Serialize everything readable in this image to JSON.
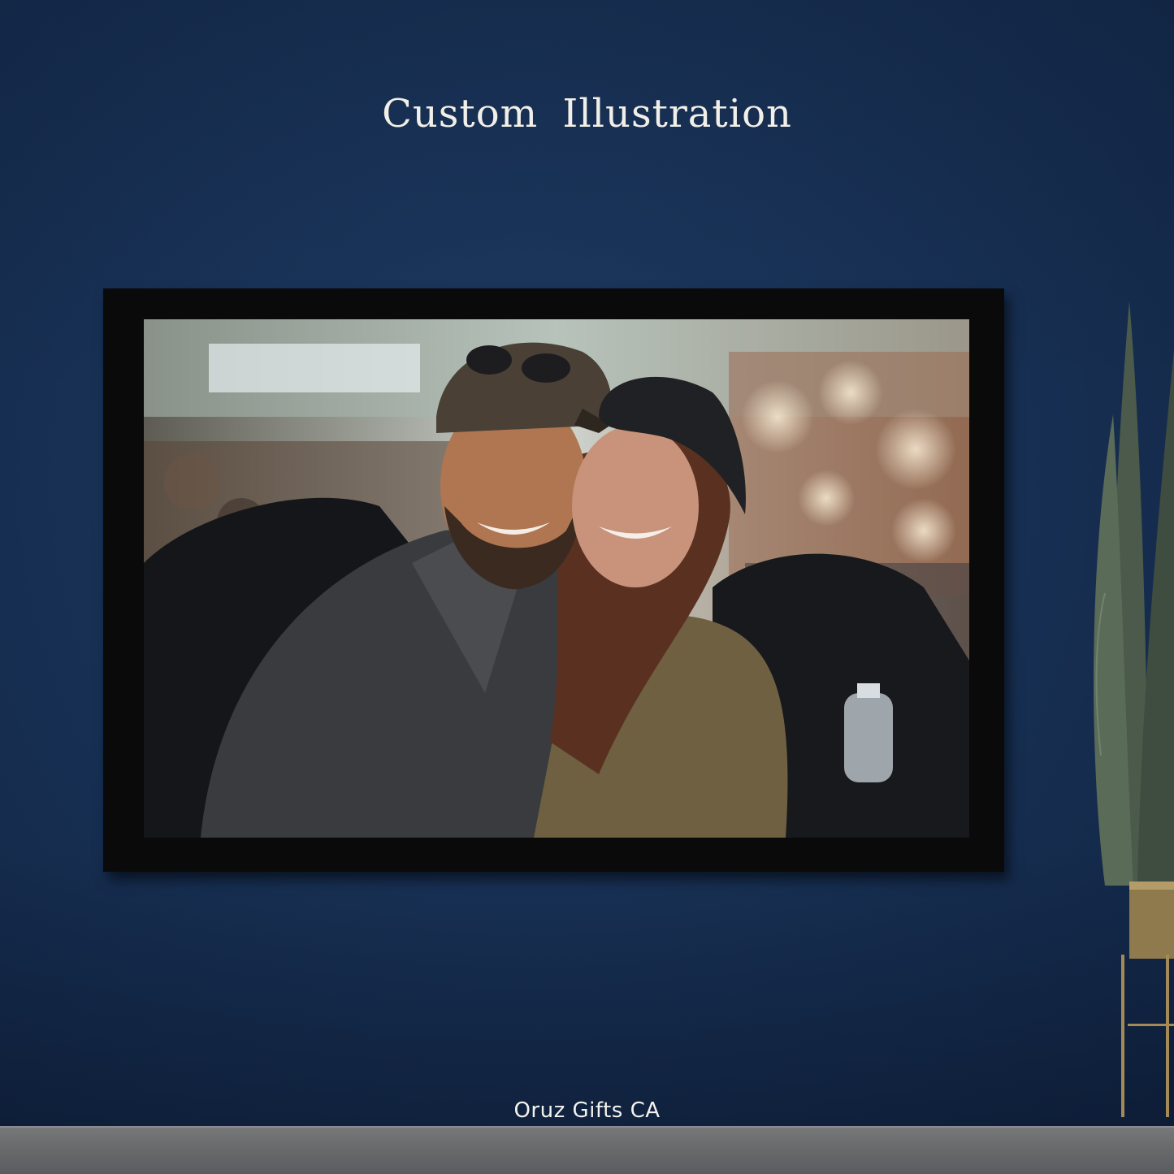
{
  "scene": {
    "title": "Custom Illustration",
    "brand": "Oruz Gifts CA",
    "colors": {
      "wall": "#183155",
      "frame": "#0a0a0b",
      "floor": "#6a6b6d",
      "text": "#f2efe8"
    }
  },
  "artwork": {
    "subject": "illustrated-couple-portrait",
    "icon": "portrait-illustration-icon"
  },
  "decor": {
    "plant_icon": "snake-plant-icon",
    "pot_icon": "brass-planter-icon"
  }
}
